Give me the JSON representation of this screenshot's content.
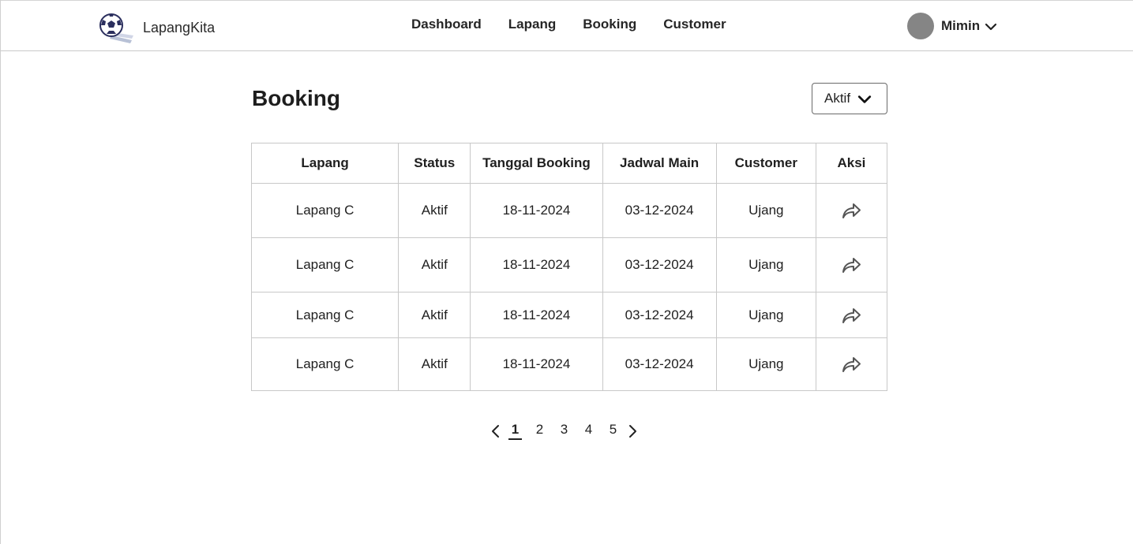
{
  "brand": {
    "name": "LapangKita",
    "logo_icon": "soccer-ball-icon"
  },
  "nav": {
    "items": [
      "Dashboard",
      "Lapang",
      "Booking",
      "Customer"
    ]
  },
  "user": {
    "name": "Mimin"
  },
  "page": {
    "title": "Booking"
  },
  "filter": {
    "selected": "Aktif"
  },
  "table": {
    "headers": [
      "Lapang",
      "Status",
      "Tanggal Booking",
      "Jadwal Main",
      "Customer",
      "Aksi"
    ],
    "rows": [
      {
        "lapang": "Lapang C",
        "status": "Aktif",
        "tanggal_booking": "18-11-2024",
        "jadwal_main": "03-12-2024",
        "customer": "Ujang",
        "aksi_icon": "share-forward-icon"
      },
      {
        "lapang": "Lapang C",
        "status": "Aktif",
        "tanggal_booking": "18-11-2024",
        "jadwal_main": "03-12-2024",
        "customer": "Ujang",
        "aksi_icon": "share-forward-icon"
      },
      {
        "lapang": "Lapang C",
        "status": "Aktif",
        "tanggal_booking": "18-11-2024",
        "jadwal_main": "03-12-2024",
        "customer": "Ujang",
        "aksi_icon": "share-forward-icon"
      },
      {
        "lapang": "Lapang C",
        "status": "Aktif",
        "tanggal_booking": "18-11-2024",
        "jadwal_main": "03-12-2024",
        "customer": "Ujang",
        "aksi_icon": "share-forward-icon"
      }
    ]
  },
  "pagination": {
    "pages": [
      "1",
      "2",
      "3",
      "4",
      "5"
    ],
    "current": "1"
  },
  "colors": {
    "avatar": "#858585",
    "border": "#c8c8c8",
    "text": "#1f1f1f"
  }
}
